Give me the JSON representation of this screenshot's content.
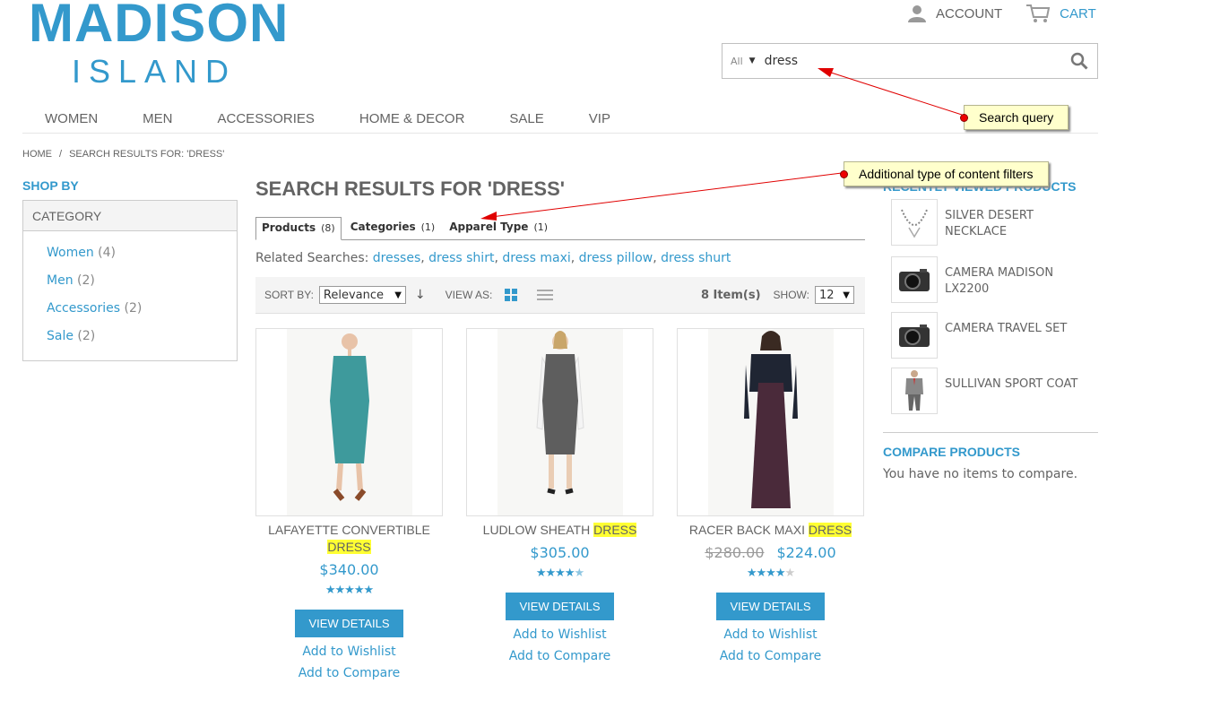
{
  "logo": {
    "main": "MADISON",
    "sub": "ISLAND"
  },
  "header": {
    "account_label": "ACCOUNT",
    "cart_label": "CART",
    "icons": {
      "account": "user-icon",
      "cart": "cart-icon",
      "search": "search-icon"
    }
  },
  "search": {
    "scope": "All",
    "value": "dress"
  },
  "nav": [
    "WOMEN",
    "MEN",
    "ACCESSORIES",
    "HOME & DECOR",
    "SALE",
    "VIP"
  ],
  "breadcrumb": {
    "home": "HOME",
    "sep": "/",
    "current": "SEARCH RESULTS FOR: 'DRESS'"
  },
  "sidebar": {
    "shop_by": "SHOP BY",
    "category_title": "CATEGORY",
    "categories": [
      {
        "label": "Women",
        "count": "(4)"
      },
      {
        "label": "Men",
        "count": "(2)"
      },
      {
        "label": "Accessories",
        "count": "(2)"
      },
      {
        "label": "Sale",
        "count": "(2)"
      }
    ]
  },
  "main": {
    "title": "SEARCH RESULTS FOR 'DRESS'",
    "tabs": [
      {
        "label": "Products",
        "count": "(8)"
      },
      {
        "label": "Categories",
        "count": "(1)"
      },
      {
        "label": "Apparel Type",
        "count": "(1)"
      }
    ],
    "related_label": "Related Searches:",
    "related": [
      "dresses",
      "dress shirt",
      "dress maxi",
      "dress pillow",
      "dress shurt"
    ],
    "related_sep": ","
  },
  "toolbar": {
    "sort_by_label": "SORT BY:",
    "sort_value": "Relevance",
    "view_as_label": "VIEW AS:",
    "items_count": "8 Item(s)",
    "show_label": "SHOW:",
    "show_value": "12"
  },
  "products": [
    {
      "name_plain": "LAFAYETTE CONVERTIBLE",
      "name_highlight": "DRESS",
      "old_price": "",
      "price": "$340.00",
      "rating": 5,
      "button": "VIEW DETAILS",
      "wishlist": "Add to Wishlist",
      "compare": "Add to Compare",
      "dress_color": "#3e9a9c"
    },
    {
      "name_plain": "LUDLOW SHEATH",
      "name_highlight": "DRESS",
      "old_price": "",
      "price": "$305.00",
      "rating": 4.5,
      "button": "VIEW DETAILS",
      "wishlist": "Add to Wishlist",
      "compare": "Add to Compare",
      "dress_color": "#5e5e5e"
    },
    {
      "name_plain": "RACER BACK MAXI",
      "name_highlight": "DRESS",
      "old_price": "$280.00",
      "price": "$224.00",
      "rating": 4,
      "button": "VIEW DETAILS",
      "wishlist": "Add to Wishlist",
      "compare": "Add to Compare",
      "dress_color": "#4a2a3a"
    }
  ],
  "recently_viewed": {
    "title": "RECENTLY VIEWED PRODUCTS",
    "items": [
      {
        "line1": "SILVER DESERT",
        "line2": "NECKLACE",
        "icon": "necklace-icon"
      },
      {
        "line1": "CAMERA MADISON",
        "line2": "LX2200",
        "icon": "camera-icon"
      },
      {
        "line1": "CAMERA TRAVEL SET",
        "line2": "",
        "icon": "camera-icon"
      },
      {
        "line1": "SULLIVAN SPORT COAT",
        "line2": "",
        "icon": "suit-icon"
      }
    ]
  },
  "compare": {
    "title": "COMPARE PRODUCTS",
    "text": "You have no items to compare."
  },
  "annotations": {
    "search_query": "Search query",
    "content_filters": "Additional type of content filters"
  },
  "colors": {
    "accent": "#3399cc",
    "highlight": "#ffff33",
    "callout_bg": "#ffffcc",
    "arrow": "#e00000"
  }
}
